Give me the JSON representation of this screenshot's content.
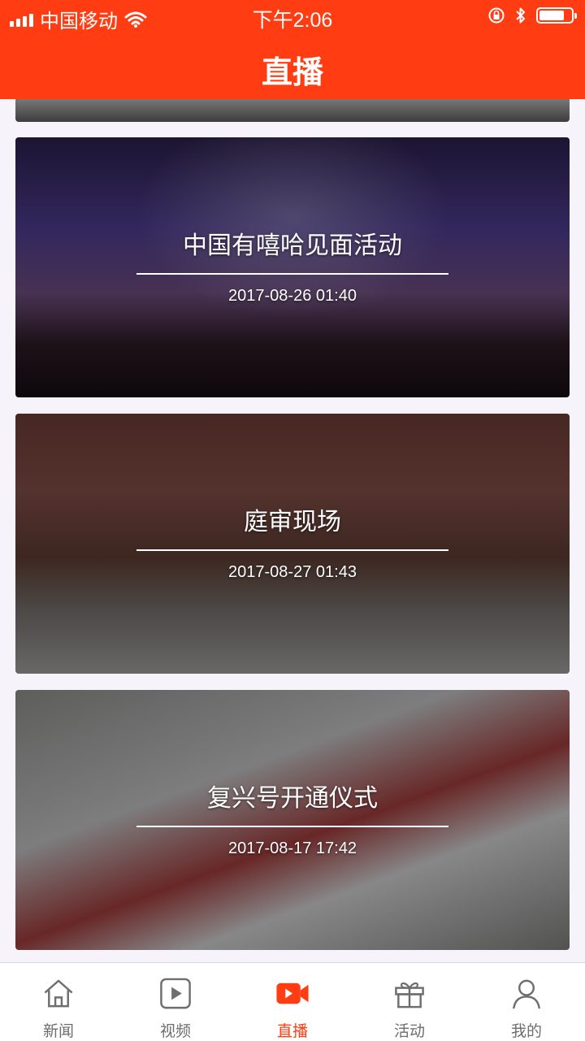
{
  "status_bar": {
    "carrier": "中国移动",
    "time": "下午2:06"
  },
  "header": {
    "title": "直播"
  },
  "cards": [
    {
      "title": "中国有嘻哈见面活动",
      "time": "2017-08-26 01:40"
    },
    {
      "title": "庭审现场",
      "time": "2017-08-27 01:43"
    },
    {
      "title": "复兴号开通仪式",
      "time": "2017-08-17 17:42"
    }
  ],
  "tabs": [
    {
      "label": "新闻",
      "icon": "home-icon"
    },
    {
      "label": "视频",
      "icon": "play-icon"
    },
    {
      "label": "直播",
      "icon": "live-camera-icon",
      "active": true
    },
    {
      "label": "活动",
      "icon": "gift-icon"
    },
    {
      "label": "我的",
      "icon": "user-icon"
    }
  ],
  "colors": {
    "brand": "#ff3c12",
    "tab_inactive": "#6e6e6e"
  }
}
